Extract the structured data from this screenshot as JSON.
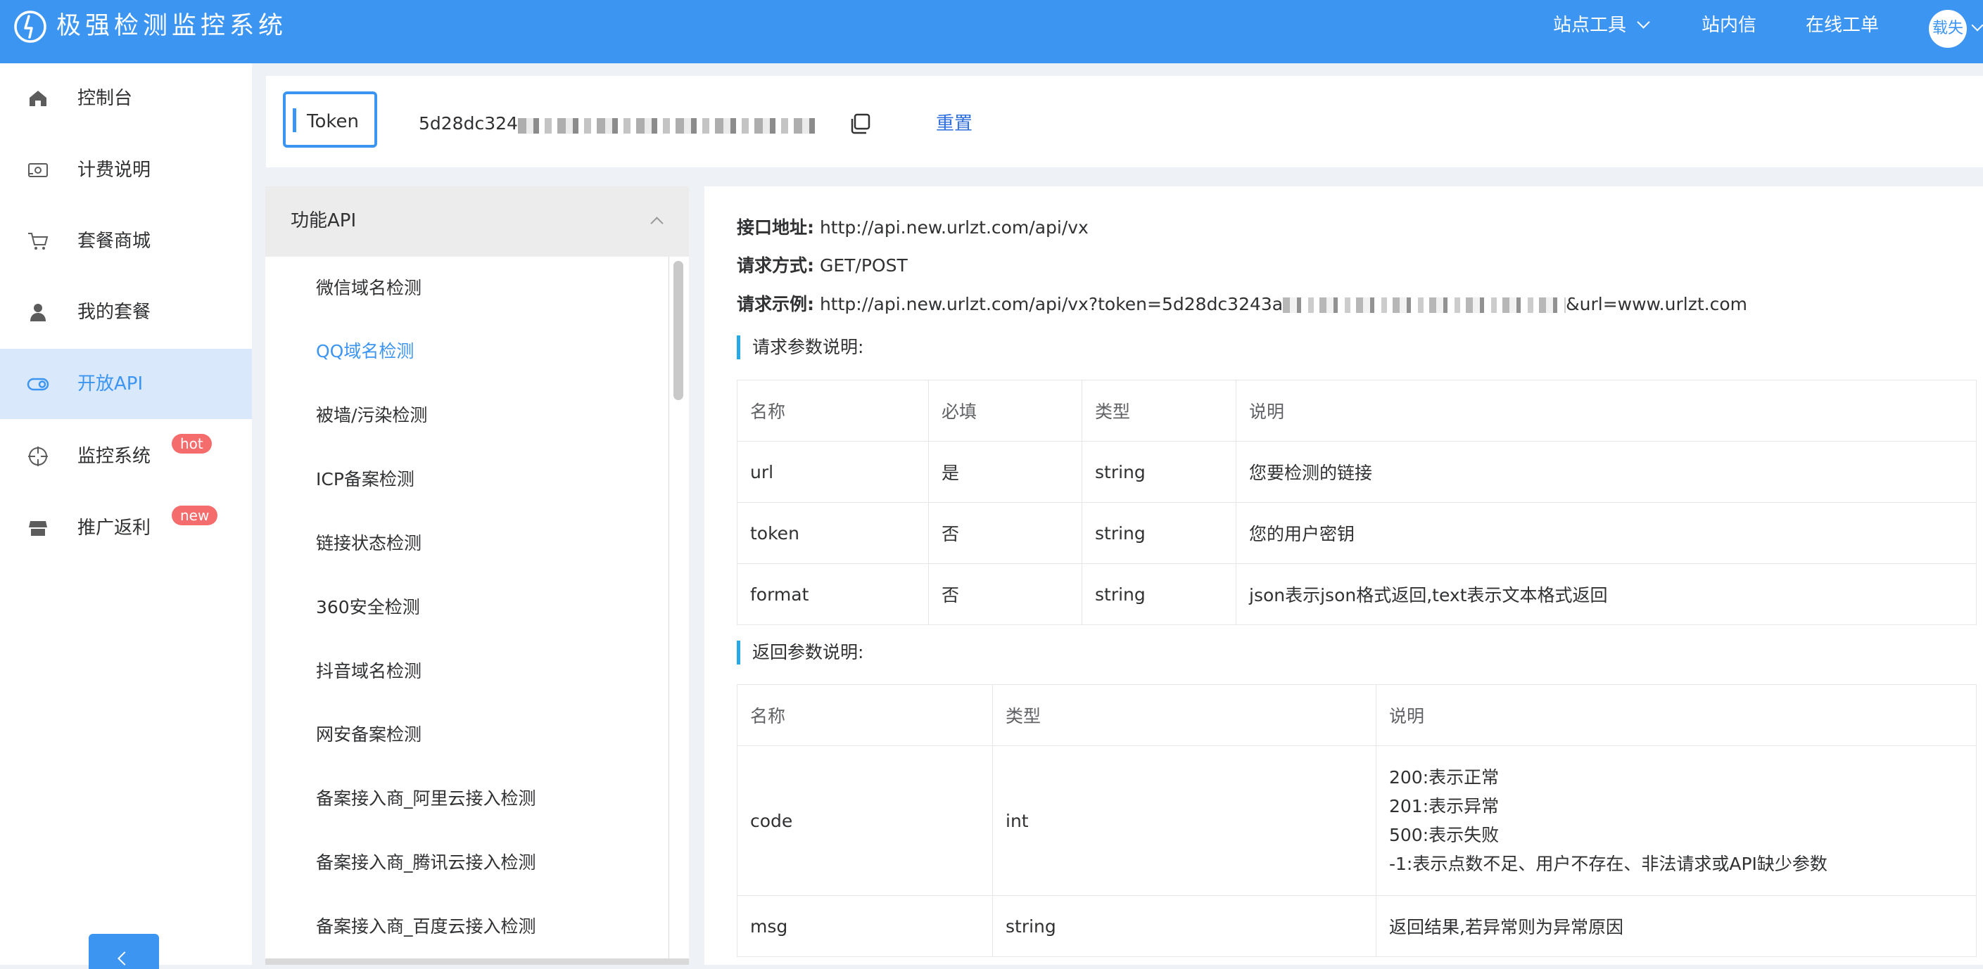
{
  "app": {
    "title": "极强检测监控系统"
  },
  "header": {
    "nav": [
      {
        "label": "站点工具",
        "has_caret": true
      },
      {
        "label": "站内信"
      },
      {
        "label": "在线工单"
      }
    ],
    "avatar_text": "载失"
  },
  "sidebar": {
    "items": [
      {
        "label": "控制台",
        "icon": "home-icon"
      },
      {
        "label": "计费说明",
        "icon": "billing-icon"
      },
      {
        "label": "套餐商城",
        "icon": "cart-icon"
      },
      {
        "label": "我的套餐",
        "icon": "user-icon"
      },
      {
        "label": "开放API",
        "icon": "toggle-icon",
        "active": true
      },
      {
        "label": "监控系统",
        "icon": "monitor-icon",
        "badge": "hot"
      },
      {
        "label": "推广返利",
        "icon": "shop-icon",
        "badge": "new"
      }
    ]
  },
  "token": {
    "label": "Token",
    "value_visible": "5d28dc324",
    "reset_label": "重置"
  },
  "api_list": {
    "title": "功能API",
    "items": [
      "微信域名检测",
      "QQ域名检测",
      "被墙/污染检测",
      "ICP备案检测",
      "链接状态检测",
      "360安全检测",
      "抖音域名检测",
      "网安备案检测",
      "备案接入商_阿里云接入检测",
      "备案接入商_腾讯云接入检测",
      "备案接入商_百度云接入检测"
    ],
    "active_index": 1
  },
  "doc": {
    "endpoint_label": "接口地址:",
    "endpoint_value": "http://api.new.urlzt.com/api/vx",
    "method_label": "请求方式:",
    "method_value": "GET/POST",
    "example_label": "请求示例:",
    "example_prefix": "http://api.new.urlzt.com/api/vx?token=5d28dc3243a",
    "example_suffix": "&url=www.urlzt.com",
    "request_title": "请求参数说明:",
    "request_headers": [
      "名称",
      "必填",
      "类型",
      "说明"
    ],
    "request_rows": [
      [
        "url",
        "是",
        "string",
        "您要检测的链接"
      ],
      [
        "token",
        "否",
        "string",
        "您的用户密钥"
      ],
      [
        "format",
        "否",
        "string",
        "json表示json格式返回,text表示文本格式返回"
      ]
    ],
    "response_title": "返回参数说明:",
    "response_headers": [
      "名称",
      "类型",
      "说明"
    ],
    "response_rows": [
      {
        "name": "code",
        "type": "int",
        "desc": [
          "200:表示正常",
          "201:表示异常",
          "500:表示失败",
          "-1:表示点数不足、用户不存在、非法请求或API缺少参数"
        ]
      },
      {
        "name": "msg",
        "type": "string",
        "desc": [
          "返回结果,若异常则为异常原因"
        ]
      }
    ]
  },
  "colors": {
    "primary": "#3d95f2",
    "badge": "#f56c6c",
    "link": "#2f6fde",
    "section_bar": "#27a9e6"
  }
}
